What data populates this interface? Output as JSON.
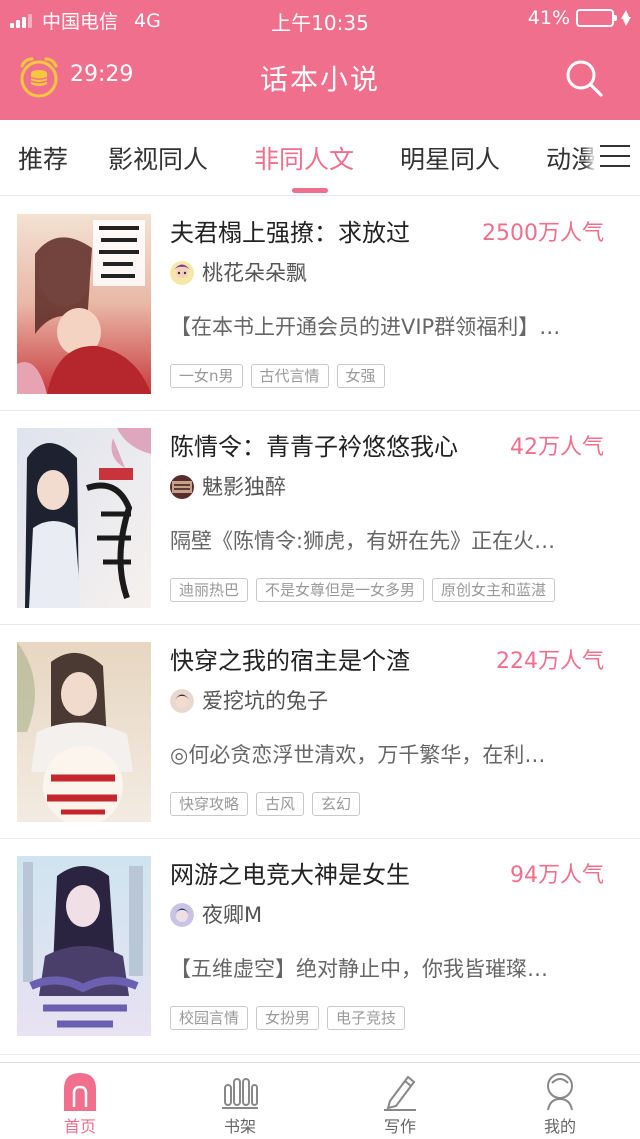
{
  "status_bar": {
    "carrier": "中国电信",
    "network": "4G",
    "time": "上午10:35",
    "battery": "41%",
    "battery_level": 0.41
  },
  "header": {
    "timer": "29:29",
    "title": "话本小说",
    "icons": [
      "alarm-clock-coin-icon",
      "search-icon"
    ]
  },
  "tabs": [
    {
      "label": "推荐",
      "active": false
    },
    {
      "label": "影视同人",
      "active": false
    },
    {
      "label": "非同人文",
      "active": true
    },
    {
      "label": "明星同人",
      "active": false
    },
    {
      "label": "动漫",
      "active": false
    }
  ],
  "books": [
    {
      "title": "夫君榻上强撩：求放过",
      "popularity": "2500万人气",
      "author": "桃花朵朵飘",
      "description": "【在本书上开通会员的进VIP群领福利】…",
      "tags": [
        "一女n男",
        "古代言情",
        "女强"
      ]
    },
    {
      "title": "陈情令：青青子衿悠悠我心",
      "popularity": "42万人气",
      "author": "魅影独醉",
      "description": "隔壁《陈情令:狮虎，有妍在先》正在火…",
      "tags": [
        "迪丽热巴",
        "不是女尊但是一女多男",
        "原创女主和蓝湛"
      ]
    },
    {
      "title": "快穿之我的宿主是个渣",
      "popularity": "224万人气",
      "author": "爱挖坑的兔子",
      "description": "◎何必贪恋浮世清欢，万千繁华，在利…",
      "tags": [
        "快穿攻略",
        "古风",
        "玄幻"
      ]
    },
    {
      "title": "网游之电竞大神是女生",
      "popularity": "94万人气",
      "author": "夜卿M",
      "description": "【五维虚空】绝对静止中，你我皆璀璨…",
      "tags": [
        "校园言情",
        "女扮男",
        "电子竞技"
      ]
    }
  ],
  "tabbar": [
    {
      "label": "首页",
      "icon": "home-icon",
      "active": true
    },
    {
      "label": "书架",
      "icon": "bookshelf-icon",
      "active": false
    },
    {
      "label": "写作",
      "icon": "pen-icon",
      "active": false
    },
    {
      "label": "我的",
      "icon": "profile-icon",
      "active": false
    }
  ],
  "colors": {
    "accent": "#ef6f8d",
    "tag_border": "#c9c9c9",
    "text": "#222222"
  }
}
